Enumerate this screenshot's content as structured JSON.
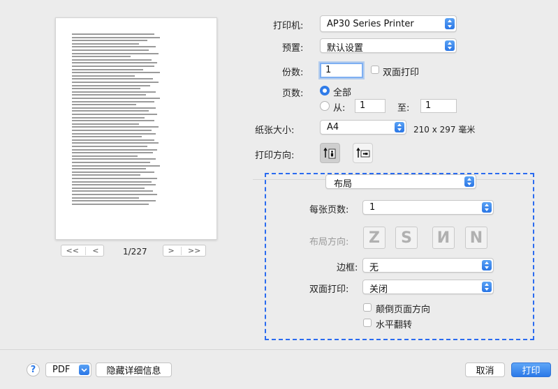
{
  "preview": {
    "nav": {
      "first": "<<",
      "prev": "<",
      "next": ">",
      "last": ">>"
    },
    "page_indicator": "1/227"
  },
  "printer": {
    "label": "打印机:",
    "value": "AP30 Series Printer"
  },
  "preset": {
    "label": "预置:",
    "value": "默认设置"
  },
  "copies": {
    "label": "份数:",
    "value": "1",
    "duplex_label": "双面打印"
  },
  "pages": {
    "label": "页数:",
    "all_label": "全部",
    "from_label": "从:",
    "from_value": "1",
    "to_label": "至:",
    "to_value": "1"
  },
  "paper": {
    "label": "纸张大小:",
    "value": "A4",
    "dimensions": "210 x 297 毫米"
  },
  "orientation": {
    "label": "打印方向:"
  },
  "section": {
    "value": "布局"
  },
  "layout": {
    "pages_per_sheet_label": "每张页数:",
    "pages_per_sheet_value": "1",
    "direction_label": "布局方向:",
    "border_label": "边框:",
    "border_value": "无",
    "two_sided_label": "双面打印:",
    "two_sided_value": "关闭",
    "reverse_label": "颠倒页面方向",
    "flip_label": "水平翻转"
  },
  "footer": {
    "help": "?",
    "pdf_label": "PDF",
    "hide_details": "隐藏详细信息",
    "cancel": "取消",
    "print": "打印"
  },
  "colors": {
    "accent": "#2f7be8",
    "highlight_border": "#2a6bf0"
  }
}
